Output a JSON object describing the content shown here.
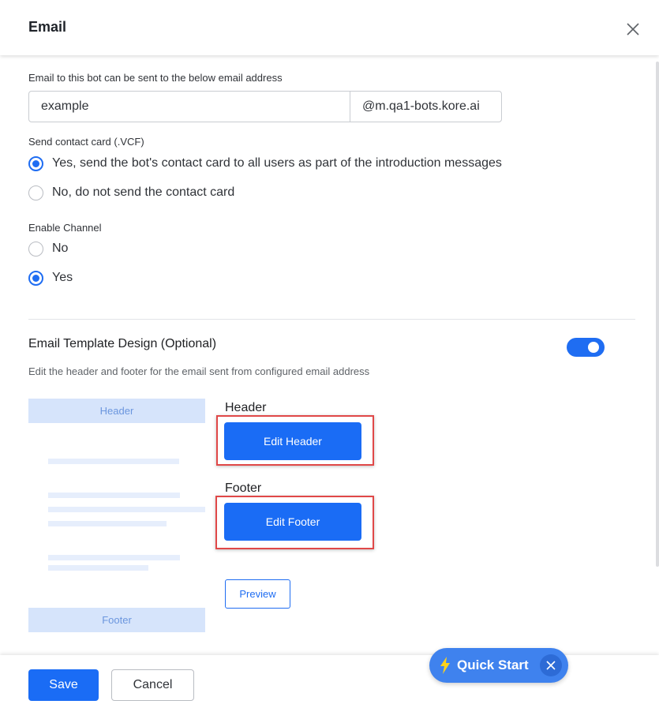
{
  "dialog": {
    "title": "Email",
    "close_icon": "close-icon"
  },
  "email": {
    "label": "Email to this bot can be sent to the below email address",
    "value": "example",
    "domain_suffix": "@m.qa1-bots.kore.ai"
  },
  "contact_card": {
    "label": "Send contact card (.VCF)",
    "options": [
      {
        "label": "Yes, send the bot's contact card to all users as part of the introduction messages",
        "selected": true
      },
      {
        "label": "No, do not send the contact card",
        "selected": false
      }
    ]
  },
  "enable_channel": {
    "label": "Enable Channel",
    "options": [
      {
        "label": "No",
        "selected": false
      },
      {
        "label": "Yes",
        "selected": true
      }
    ]
  },
  "template_design": {
    "title": "Email Template Design (Optional)",
    "description": "Edit the header and footer for the email sent from configured email address",
    "enabled": true,
    "mockup_header": "Header",
    "mockup_footer": "Footer",
    "header_label": "Header",
    "edit_header_button": "Edit Header",
    "footer_label": "Footer",
    "edit_footer_button": "Edit Footer",
    "preview_button": "Preview"
  },
  "footer": {
    "save_label": "Save",
    "cancel_label": "Cancel"
  },
  "quick_start": {
    "label": "Quick Start",
    "icon": "lightning-bolt-icon",
    "close_icon": "close-icon"
  },
  "colors": {
    "primary": "#1a6cf5",
    "highlight": "#e04848",
    "mockup_fill": "#d6e4fb"
  }
}
